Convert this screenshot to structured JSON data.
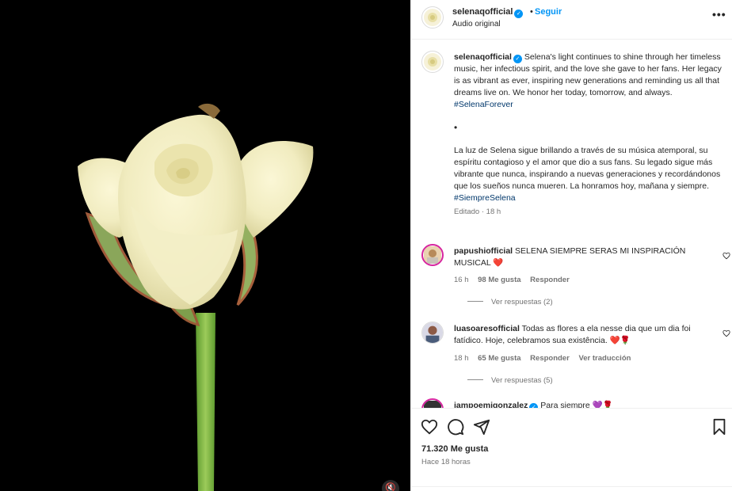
{
  "header": {
    "username": "selenaqofficial",
    "separator": "•",
    "follow_label": "Seguir",
    "audio": "Audio original",
    "more": "•••"
  },
  "caption": {
    "username": "selenaqofficial",
    "text_en": "Selena's light continues to shine through her timeless music, her infectious spirit, and the love she gave to her fans. Her legacy is as vibrant as ever, inspiring new generations and reminding us all that dreams live on. We honor her today, tomorrow, and always.",
    "hashtag_en": "#SelenaForever",
    "bullet": "•",
    "text_es": "La luz de Selena sigue brillando a través de su música atemporal, su espíritu contagioso y el amor que dio a sus fans. Su legado sigue más vibrante que nunca, inspirando a nuevas generaciones y recordándonos que los sueños nunca mueren. La honramos hoy, mañana y siempre.",
    "hashtag_es": "#SiempreSelena",
    "edited": "Editado · 18 h"
  },
  "comments": [
    {
      "username": "papushiofficial",
      "text": "SELENA SIEMPRE SERAS MI INSPIRACIÓN MUSICAL",
      "emoji": "❤️",
      "time": "16 h",
      "likes": "98 Me gusta",
      "reply": "Responder",
      "translate": "",
      "replies": "Ver respuestas (2)"
    },
    {
      "username": "luasoaresofficial",
      "text": "Todas as flores a ela nesse dia que um dia foi fatídico. Hoje, celebramos sua existência.",
      "emoji": "❤️🌹",
      "time": "18 h",
      "likes": "65 Me gusta",
      "reply": "Responder",
      "translate": "Ver traducción",
      "replies": "Ver respuestas (5)"
    },
    {
      "username": "iampoemigonzalez",
      "text": "Para siempre",
      "emoji": "💜🌹"
    }
  ],
  "footer": {
    "likes": "71.320 Me gusta",
    "ago": "Hace 18 horas"
  },
  "colors": {
    "accent": "#0095f6",
    "hashtag": "#00376b",
    "heart": "#ed4956",
    "muted": "#737373"
  }
}
